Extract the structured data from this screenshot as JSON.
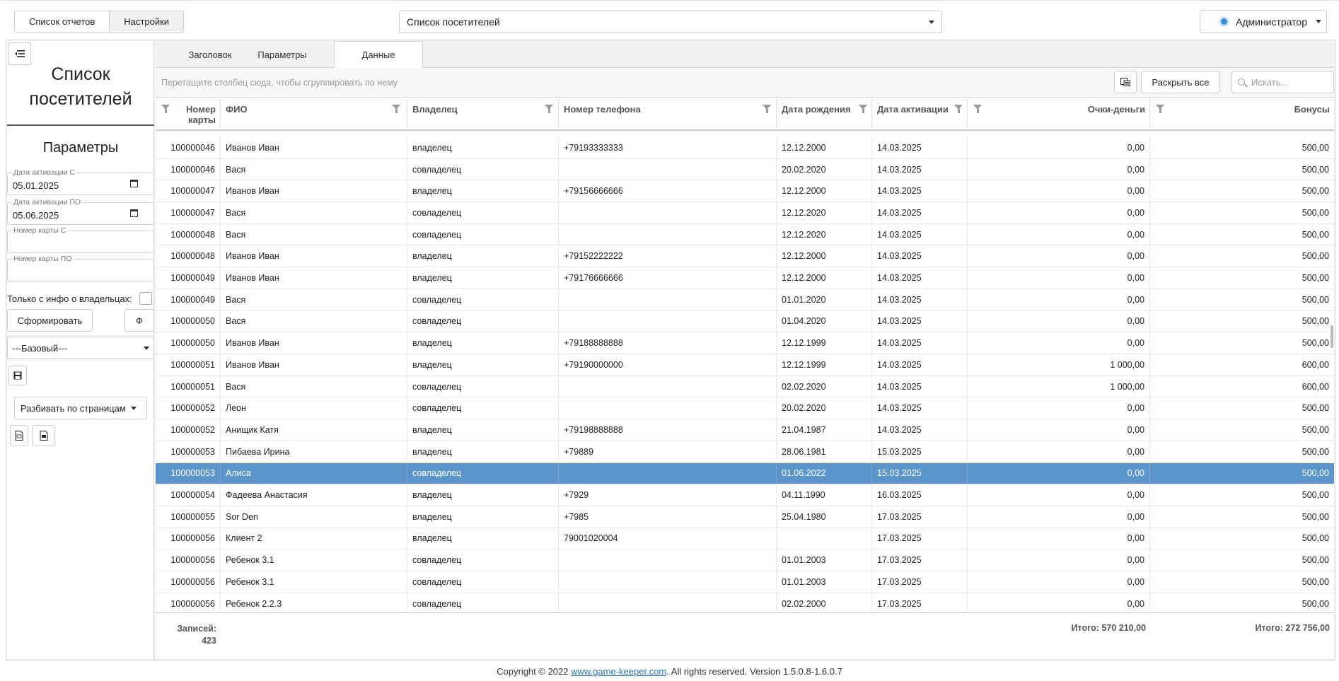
{
  "topnav": {
    "reports": "Список отчетов",
    "settings": "Настройки"
  },
  "report_select": {
    "value": "Список посетителей"
  },
  "user": {
    "name": "Администратор"
  },
  "left": {
    "title_line1": "Список",
    "title_line2": "посетителей",
    "params_title": "Параметры",
    "date_from_label": "Дата активации С",
    "date_from_value": "05.01.2025",
    "date_to_label": "Дата активации ПО",
    "date_to_value": "05.06.2025",
    "card_from_label": "Номер карты С",
    "card_to_label": "Номер карты ПО",
    "owners_only_label": "Только с инфо о владельцах:",
    "build_button": "Сформировать",
    "phi_button": "Ф",
    "preset_value": "---Базовый---",
    "paging_label": "Разбивать по страницам"
  },
  "tabs": [
    "Заголовок",
    "Параметры",
    "Данные"
  ],
  "toolbar": {
    "group_hint": "Перетащите столбец сюда, чтобы сгруппировать по нему",
    "expand_all": "Раскрыть все",
    "search_placeholder": "Искать..."
  },
  "columns": [
    "Номер карты",
    "ФИО",
    "Владелец",
    "Номер телефона",
    "Дата рождения",
    "Дата активации",
    "Очки-деньги",
    "Бонусы"
  ],
  "rows": [
    [
      "100000046",
      "Иванов Иван",
      "владелец",
      "+79193333333",
      "12.12.2000",
      "14.03.2025",
      "0,00",
      "500,00"
    ],
    [
      "100000046",
      "Вася",
      "совладелец",
      "",
      "20.02.2020",
      "14.03.2025",
      "0,00",
      "500,00"
    ],
    [
      "100000047",
      "Иванов Иван",
      "владелец",
      "+79156666666",
      "12.12.2000",
      "14.03.2025",
      "0,00",
      "500,00"
    ],
    [
      "100000047",
      "Вася",
      "совладелец",
      "",
      "12.12.2020",
      "14.03.2025",
      "0,00",
      "500,00"
    ],
    [
      "100000048",
      "Вася",
      "совладелец",
      "",
      "12.12.2020",
      "14.03.2025",
      "0,00",
      "500,00"
    ],
    [
      "100000048",
      "Иванов Иван",
      "владелец",
      "+79152222222",
      "12.12.2000",
      "14.03.2025",
      "0,00",
      "500,00"
    ],
    [
      "100000049",
      "Иванов Иван",
      "владелец",
      "+79176666666",
      "12.12.2000",
      "14.03.2025",
      "0,00",
      "500,00"
    ],
    [
      "100000049",
      "Вася",
      "совладелец",
      "",
      "01.01.2020",
      "14.03.2025",
      "0,00",
      "500,00"
    ],
    [
      "100000050",
      "Вася",
      "совладелец",
      "",
      "01.04.2020",
      "14.03.2025",
      "0,00",
      "500,00"
    ],
    [
      "100000050",
      "Иванов Иван",
      "владелец",
      "+79188888888",
      "12.12.1999",
      "14.03.2025",
      "0,00",
      "500,00"
    ],
    [
      "100000051",
      "Иванов Иван",
      "владелец",
      "+79190000000",
      "12.12.1999",
      "14.03.2025",
      "1 000,00",
      "600,00"
    ],
    [
      "100000051",
      "Вася",
      "совладелец",
      "",
      "02.02.2020",
      "14.03.2025",
      "1 000,00",
      "600,00"
    ],
    [
      "100000052",
      "Леон",
      "совладелец",
      "",
      "20.02.2020",
      "14.03.2025",
      "0,00",
      "500,00"
    ],
    [
      "100000052",
      "Анищик Катя",
      "владелец",
      "+79198888888",
      "21.04.1987",
      "14.03.2025",
      "0,00",
      "500,00"
    ],
    [
      "100000053",
      "Пибаева Ирина",
      "владелец",
      "+79889",
      "28.06.1981",
      "15.03.2025",
      "0,00",
      "500,00"
    ],
    [
      "100000053",
      "Алиса",
      "совладелец",
      "",
      "01.06.2022",
      "15.03.2025",
      "0,00",
      "500,00"
    ],
    [
      "100000054",
      "Фадеева Анастасия",
      "владелец",
      "+7929",
      "04.11.1990",
      "16.03.2025",
      "0,00",
      "500,00"
    ],
    [
      "100000055",
      "Sor Den",
      "владелец",
      "+7985",
      "25.04.1980",
      "17.03.2025",
      "0,00",
      "500,00"
    ],
    [
      "100000056",
      "Клиент 2",
      "владелец",
      "79001020004",
      "",
      "17.03.2025",
      "0,00",
      "500,00"
    ],
    [
      "100000056",
      "Ребенок 3.1",
      "совладелец",
      "",
      "01.01.2003",
      "17.03.2025",
      "0,00",
      "500,00"
    ],
    [
      "100000056",
      "Ребенок 3.1",
      "совладелец",
      "",
      "01.01.2003",
      "17.03.2025",
      "0,00",
      "500,00"
    ],
    [
      "100000056",
      "Ребенок 2.2.3",
      "совладелец",
      "",
      "02.02.2000",
      "17.03.2025",
      "0,00",
      "500,00"
    ]
  ],
  "selected_row": 15,
  "summary": {
    "records_label": "Записей:",
    "records_count": "423",
    "points_total": "Итого: 570 210,00",
    "bonus_total": "Итого: 272 756,00"
  },
  "footer": {
    "prefix": "Copyright © 2022 ",
    "link": "www.game-keeper.com",
    "suffix": ". All rights reserved.   Version 1.5.0.8-1.6.0.7"
  },
  "colors": {
    "selected_row": "#5b95c9",
    "link": "#2a6fba"
  }
}
